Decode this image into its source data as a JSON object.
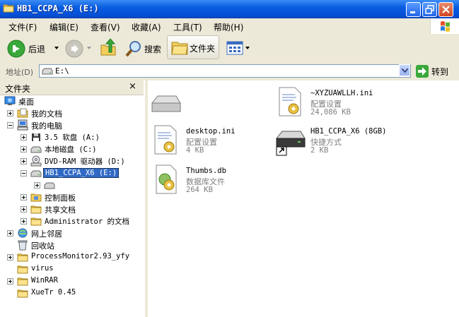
{
  "window": {
    "title": "HB1_CCPA_X6 (E:)"
  },
  "menu": [
    "文件(F)",
    "编辑(E)",
    "查看(V)",
    "收藏(A)",
    "工具(T)",
    "帮助(H)"
  ],
  "toolbar": {
    "back": "后退",
    "search": "搜索",
    "folders": "文件夹"
  },
  "address": {
    "label": "地址(D)",
    "value": "E:\\",
    "go": "转到"
  },
  "folder_pane": {
    "title": "文件夹",
    "close": "×",
    "items": [
      {
        "label": "桌面",
        "icon": "desktop-icon"
      },
      {
        "label": "我的文档",
        "icon": "my-documents-icon"
      },
      {
        "label": "我的电脑",
        "icon": "my-computer-icon"
      },
      {
        "label": "3.5 软盘 (A:)",
        "icon": "floppy-icon"
      },
      {
        "label": "本地磁盘 (C:)",
        "icon": "hard-disk-icon"
      },
      {
        "label": "DVD-RAM 驱动器 (D:)",
        "icon": "dvd-drive-icon"
      },
      {
        "label": "HB1_CCPA_X6 (E:)",
        "icon": "removable-drive-icon"
      },
      {
        "label": "",
        "icon": "drive-icon"
      },
      {
        "label": "控制面板",
        "icon": "control-panel-icon"
      },
      {
        "label": "共享文档",
        "icon": "folder-icon"
      },
      {
        "label": "Administrator 的文档",
        "icon": "folder-icon"
      },
      {
        "label": "网上邻居",
        "icon": "network-icon"
      },
      {
        "label": "回收站",
        "icon": "recycle-bin-icon"
      },
      {
        "label": "ProcessMonitor2.93_yfy",
        "icon": "folder-icon"
      },
      {
        "label": "virus",
        "icon": "folder-icon"
      },
      {
        "label": "WinRAR",
        "icon": "folder-icon"
      },
      {
        "label": "XueTr 0.45",
        "icon": "folder-icon"
      }
    ]
  },
  "files": [
    {
      "name": "",
      "type": "",
      "size": "",
      "icon": "drive-icon"
    },
    {
      "name": "~XYZUAWLLH.ini",
      "type": "配置设置",
      "size": "24,086 KB",
      "icon": "config-file-icon"
    },
    {
      "name": "desktop.ini",
      "type": "配置设置",
      "size": "4 KB",
      "icon": "config-file-icon"
    },
    {
      "name": "HB1_CCPA_X6 (8GB)",
      "type": "快捷方式",
      "size": "2 KB",
      "icon": "drive-shortcut-icon"
    },
    {
      "name": "Thumbs.db",
      "type": "数据库文件",
      "size": "264 KB",
      "icon": "database-file-icon"
    }
  ]
}
